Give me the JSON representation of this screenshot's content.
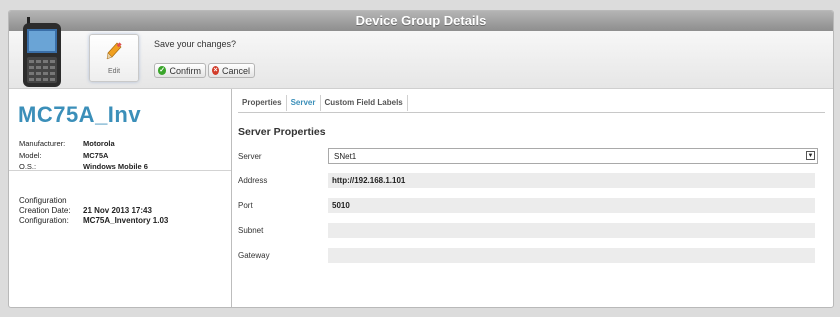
{
  "window": {
    "title": "Device Group Details"
  },
  "toolbar": {
    "edit_label": "Edit",
    "prompt": "Save your changes?",
    "confirm_label": "Confirm",
    "cancel_label": "Cancel"
  },
  "device": {
    "name": "MC75A_Inv",
    "info": [
      {
        "key": "Manufacturer:",
        "value": "Motorola"
      },
      {
        "key": "Model:",
        "value": "MC75A"
      },
      {
        "key": "O.S.:",
        "value": "Windows Mobile 6"
      }
    ],
    "configuration": {
      "heading": "Configuration",
      "creation_key": "Creation Date:",
      "creation_value": "21 Nov 2013 17:43",
      "config_key": "Configuration:",
      "config_value": "MC75A_Inventory 1.03"
    }
  },
  "tabs": [
    {
      "label": "Properties",
      "active": false
    },
    {
      "label": "Server",
      "active": true
    },
    {
      "label": "Custom Field Labels",
      "active": false
    }
  ],
  "server": {
    "section_title": "Server Properties",
    "server_label": "Server",
    "server_value": "SNet1",
    "address_label": "Address",
    "address_value": "http://192.168.1.101",
    "port_label": "Port",
    "port_value": "5010",
    "subnet_label": "Subnet",
    "subnet_value": "",
    "gateway_label": "Gateway",
    "gateway_value": ""
  },
  "colors": {
    "accent": "#3b8fb9",
    "confirm_icon": "#3aa52b",
    "cancel_icon": "#d23c2a"
  },
  "icons": {
    "edit": "pencil-icon",
    "confirm": "check-icon",
    "cancel": "cancel-icon",
    "select": "dropdown-arrow-icon"
  }
}
